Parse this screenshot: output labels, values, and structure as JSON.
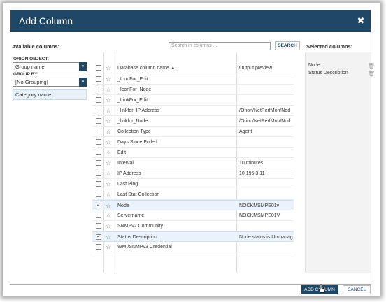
{
  "dialog": {
    "title": "Add Column",
    "close_glyph": "✖"
  },
  "available": {
    "label": "Available columns:",
    "orion_object_label": "ORION OBJECT:",
    "orion_object_value": "Group name",
    "group_by_label": "GROUP BY:",
    "group_by_value": "[No Grouping]",
    "group_list": [
      "Category name"
    ]
  },
  "search": {
    "placeholder": "Search in columns ...",
    "button_label": "SEARCH"
  },
  "grid": {
    "columns": [
      "Database column name ▲",
      "Output preview"
    ],
    "rows": [
      {
        "name": "_IconFor_Edit",
        "preview": "",
        "checked": false
      },
      {
        "name": "_IconFor_Node",
        "preview": "",
        "checked": false
      },
      {
        "name": "_LinkFor_Edit",
        "preview": "",
        "checked": false
      },
      {
        "name": "_linkfor_IP Address",
        "preview": "/Orion/NetPerfMon/Nod",
        "checked": false
      },
      {
        "name": "_linkfor_Node",
        "preview": "/Orion/NetPerfMon/Nod",
        "checked": false
      },
      {
        "name": "Collection Type",
        "preview": "Agent",
        "checked": false
      },
      {
        "name": "Days Since Polled",
        "preview": "",
        "checked": false
      },
      {
        "name": "Edit",
        "preview": "",
        "checked": false
      },
      {
        "name": "Interval",
        "preview": "10 minutes",
        "checked": false
      },
      {
        "name": "IP Address",
        "preview": "10.196.3.11",
        "checked": false
      },
      {
        "name": "Last Ping",
        "preview": "",
        "checked": false
      },
      {
        "name": "Last Stat Collection",
        "preview": "",
        "checked": false
      },
      {
        "name": "Node",
        "preview": "NOCKMSMPE01v",
        "checked": true
      },
      {
        "name": "Servername",
        "preview": "NOCKMSMPE01V",
        "checked": false
      },
      {
        "name": "SNMPv2 Community",
        "preview": "",
        "checked": false
      },
      {
        "name": "Status Description",
        "preview": "Node status is Unmanag",
        "checked": true
      },
      {
        "name": "WMI/SNMPv3 Credential",
        "preview": "",
        "checked": false
      }
    ]
  },
  "selected": {
    "label": "Selected columns:",
    "items": [
      "Node",
      "Status Description"
    ]
  },
  "footer": {
    "add_label": "ADD COLUMN",
    "cancel_label": "CANCEL"
  },
  "colors": {
    "titlebar": "#1e4866",
    "selected_row": "#eaf3fb",
    "selected_panel": "#f3f3f3"
  },
  "icons": {
    "close": "close-icon",
    "dropdown": "chevron-down-icon",
    "favorite": "star-icon",
    "remove": "trash-icon"
  }
}
